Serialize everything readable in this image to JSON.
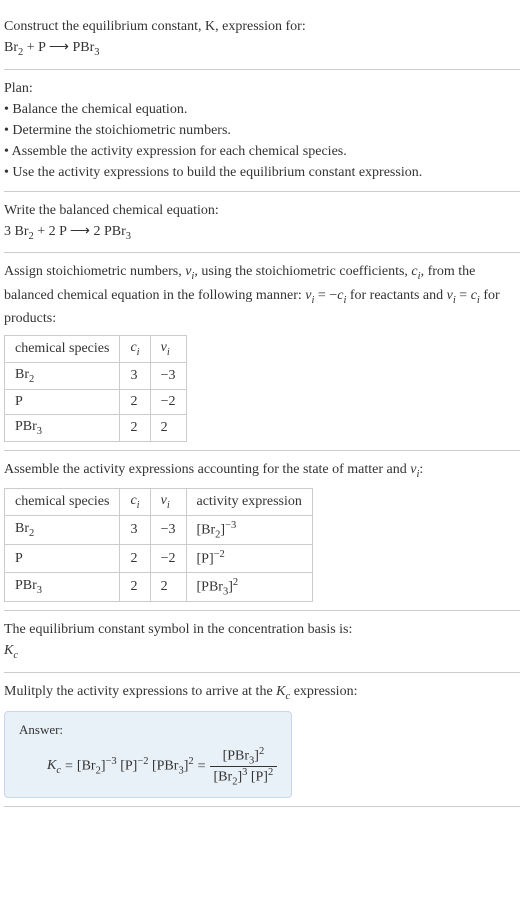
{
  "s1": {
    "l1": "Construct the equilibrium constant, K, expression for:",
    "eq": "Br₂ + P ⟶ PBr₃"
  },
  "s2": {
    "title": "Plan:",
    "b1": "• Balance the chemical equation.",
    "b2": "• Determine the stoichiometric numbers.",
    "b3": "• Assemble the activity expression for each chemical species.",
    "b4": "• Use the activity expressions to build the equilibrium constant expression."
  },
  "s3": {
    "l1": "Write the balanced chemical equation:",
    "eq": "3 Br₂ + 2 P ⟶ 2 PBr₃"
  },
  "s4": {
    "l1_a": "Assign stoichiometric numbers, ",
    "l1_b": ", using the stoichiometric coefficients, ",
    "l1_c": ", from the balanced chemical equation in the following manner: ",
    "l1_d": " for reactants and ",
    "l1_e": " for products:",
    "table": {
      "h1": "chemical species",
      "h2": "cᵢ",
      "h3": "νᵢ",
      "r1c1": "Br₂",
      "r1c2": "3",
      "r1c3": "−3",
      "r2c1": "P",
      "r2c2": "2",
      "r2c3": "−2",
      "r3c1": "PBr₃",
      "r3c2": "2",
      "r3c3": "2"
    }
  },
  "s5": {
    "l1_a": "Assemble the activity expressions accounting for the state of matter and ",
    "l1_b": ":",
    "table": {
      "h1": "chemical species",
      "h2": "cᵢ",
      "h3": "νᵢ",
      "h4": "activity expression",
      "r1c1": "Br₂",
      "r1c2": "3",
      "r1c3": "−3",
      "r2c1": "P",
      "r2c2": "2",
      "r2c3": "−2",
      "r3c1": "PBr₃",
      "r3c2": "2",
      "r3c3": "2"
    }
  },
  "s6": {
    "l1": "The equilibrium constant symbol in the concentration basis is:",
    "sym": "K꜀"
  },
  "s7": {
    "l1_a": "Mulitply the activity expressions to arrive at the ",
    "l1_b": " expression:",
    "answer": "Answer:"
  }
}
